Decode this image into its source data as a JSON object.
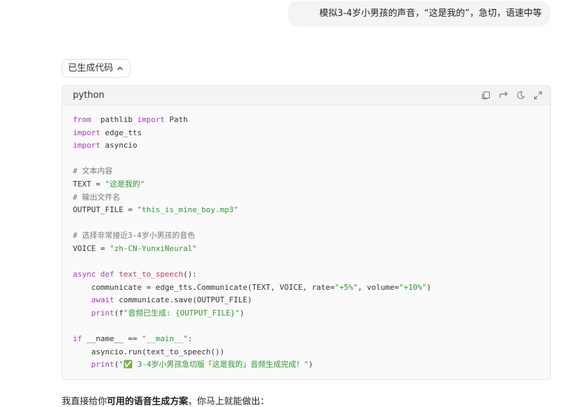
{
  "user_message": "模拟3-4岁小男孩的声音，“这是我的”，急切，语速中等",
  "code_toggle": {
    "label": "已生成代码"
  },
  "code_block": {
    "language": "python",
    "lines": [
      [
        [
          "kw",
          "from"
        ],
        [
          "",
          "  pathlib "
        ],
        [
          "kw",
          "import"
        ],
        [
          "",
          " Path"
        ]
      ],
      [
        [
          "kw",
          "import"
        ],
        [
          "",
          " edge_tts"
        ]
      ],
      [
        [
          "kw",
          "import"
        ],
        [
          "",
          " asyncio"
        ]
      ],
      [],
      [
        [
          "cm",
          "# 文本内容"
        ]
      ],
      [
        [
          "",
          "TEXT = "
        ],
        [
          "st",
          "\"这是我的\""
        ]
      ],
      [
        [
          "cm",
          "# 输出文件名"
        ]
      ],
      [
        [
          "",
          "OUTPUT_FILE = "
        ],
        [
          "st",
          "\"this_is_mine_boy.mp3\""
        ]
      ],
      [],
      [
        [
          "cm",
          "# 选择非常接近3-4岁小男孩的音色"
        ]
      ],
      [
        [
          "",
          "VOICE = "
        ],
        [
          "st",
          "\"zh-CN-YunxiNeural\""
        ]
      ],
      [],
      [
        [
          "kw",
          "async def"
        ],
        [
          "",
          " "
        ],
        [
          "fn",
          "text_to_speech"
        ],
        [
          "",
          "():"
        ]
      ],
      [
        [
          "",
          "    communicate = edge_tts.Communicate(TEXT, VOICE, rate="
        ],
        [
          "st",
          "\"+5%\""
        ],
        [
          "",
          ", volume="
        ],
        [
          "st",
          "\"+10%\""
        ],
        [
          "",
          ")"
        ]
      ],
      [
        [
          "kw",
          "    await"
        ],
        [
          "",
          " communicate.save(OUTPUT_FILE)"
        ]
      ],
      [
        [
          "kw",
          "    print"
        ],
        [
          "",
          "(f"
        ],
        [
          "st",
          "\"音频已生成: {OUTPUT_FILE}\""
        ],
        [
          "",
          ")"
        ]
      ],
      [],
      [
        [
          "kw",
          "if"
        ],
        [
          "",
          " __name__ == "
        ],
        [
          "st",
          "\"__main__\""
        ],
        [
          "",
          ":"
        ]
      ],
      [
        [
          "",
          "    asyncio.run(text_to_speech())"
        ]
      ],
      [
        [
          "kw",
          "    print"
        ],
        [
          "",
          "("
        ],
        [
          "st",
          "\"✅ 3-4岁小男孩急切版「这是我的」音频生成完成！\""
        ],
        [
          "",
          ")"
        ]
      ]
    ]
  },
  "answer": {
    "prefix": "我直接给你",
    "bold": "可用的语音生成方案",
    "suffix": "，你马上就能做出："
  },
  "icons": [
    "copy-icon",
    "wrap-icon",
    "theme-icon",
    "expand-icon"
  ]
}
